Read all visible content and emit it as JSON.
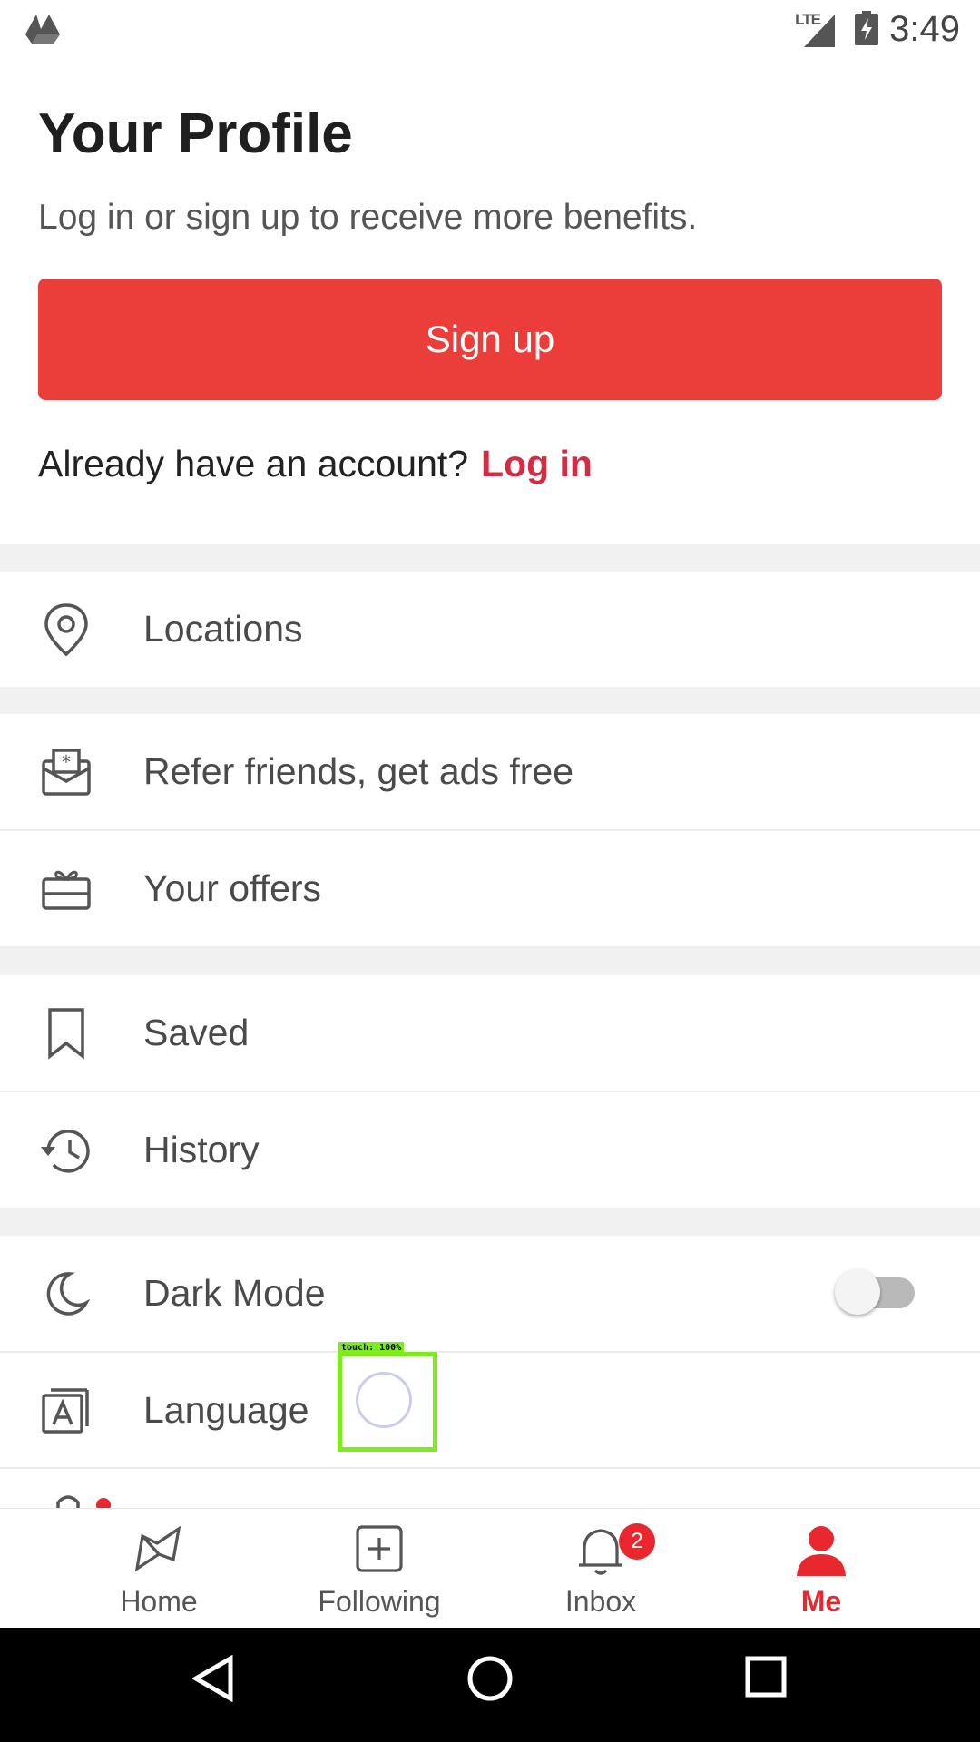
{
  "status_bar": {
    "time": "3:49",
    "network": "LTE"
  },
  "header": {
    "title": "Your Profile",
    "subtitle": "Log in or sign up to receive more benefits."
  },
  "signup_button": "Sign up",
  "login_prompt": {
    "text": "Already have an account?",
    "link": "Log in"
  },
  "menu": {
    "locations": "Locations",
    "refer": "Refer friends, get ads free",
    "offers": "Your offers",
    "saved": "Saved",
    "history": "History",
    "dark_mode": "Dark Mode",
    "dark_mode_on": false,
    "language": "Language"
  },
  "touch_overlay": "touch: 100%",
  "tabs": [
    {
      "label": "Home",
      "icon": "home-map-icon"
    },
    {
      "label": "Following",
      "icon": "plus-box-icon"
    },
    {
      "label": "Inbox",
      "icon": "bell-icon",
      "badge": "2"
    },
    {
      "label": "Me",
      "icon": "person-icon",
      "active": true
    }
  ],
  "colors": {
    "accent": "#eb3d3a",
    "link": "#d72b43",
    "active_tab": "#e8282e"
  }
}
